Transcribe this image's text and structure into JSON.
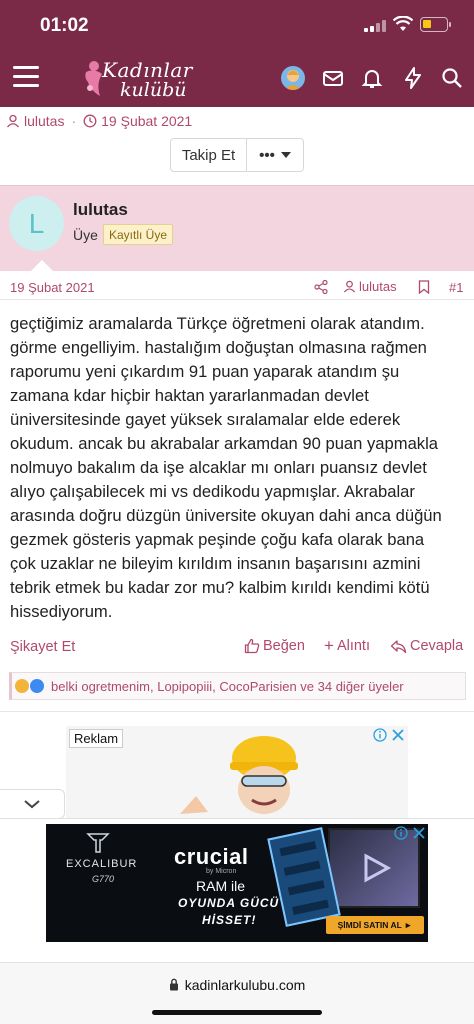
{
  "status_bar": {
    "time": "01:02"
  },
  "header": {
    "logo_line1": "Kadınlar",
    "logo_line2": "kulübü",
    "icons": [
      "menu-icon",
      "avatar",
      "mail-icon",
      "bell-icon",
      "bolt-icon",
      "search-icon"
    ]
  },
  "thread_meta": {
    "author": "lulutas",
    "date": "19 Şubat 2021"
  },
  "buttons": {
    "follow": "Takip Et",
    "more": "•••"
  },
  "post": {
    "avatar_letter": "L",
    "username": "lulutas",
    "role": "Üye",
    "badge": "Kayıtlı Üye",
    "date": "19 Şubat 2021",
    "author_link": "lulutas",
    "number": "#1",
    "body_lines": [
      "geçtiğimiz aramalarda Türkçe öğretmeni olarak atandım.",
      "görme engelliyim. hastalığım doğuştan olmasına rağmen",
      "raporumu yeni çıkardım 91 puan yaparak atandım şu",
      "zamana kdar hiçbir haktan yararlanmadan devlet",
      "üniversitesinde gayet yüksek sıralamalar elde ederek",
      "okudum. ancak bu akrabalar arkamdan 90 puan yapmakla",
      "nolmuyo bakalım da işe alcaklar mı onları puansız devlet",
      "alıyo çalışabilecek mi vs dedikodu yapmışlar. Akrabalar",
      "arasında doğru düzgün üniversite okuyan dahi anca düğün",
      "gezmek gösteris yapmak peşinde çoğu kafa olarak bana",
      "çok uzaklar ne bileyim kırıldım insanın başarısını azmini",
      "tebrik etmek bu kadar zor mu? kalbim kırıldı kendimi kötü",
      "hissediyorum."
    ]
  },
  "actions": {
    "report": "Şikayet Et",
    "like": "Beğen",
    "quote": "Alıntı",
    "reply": "Cevapla"
  },
  "reactions": {
    "text": "belki ogretmenim, Lopipopiii, CocoParisien ve 34 diğer üyeler"
  },
  "ads": {
    "label": "Reklam",
    "crucial": {
      "brand_left": "EXCALIBUR",
      "model": "G770",
      "title": "crucial",
      "sub": "by Micron",
      "ram": "RAM ile",
      "line1": "OYUNDA GÜCÜ",
      "line2": "HİSSET!",
      "cta": "ŞİMDİ SATIN AL ►"
    }
  },
  "browser": {
    "url": "kadinlarkulubu.com"
  },
  "colors": {
    "brand": "#7a2a47",
    "accent": "#b0496d",
    "post_header": "#f2d5de"
  }
}
